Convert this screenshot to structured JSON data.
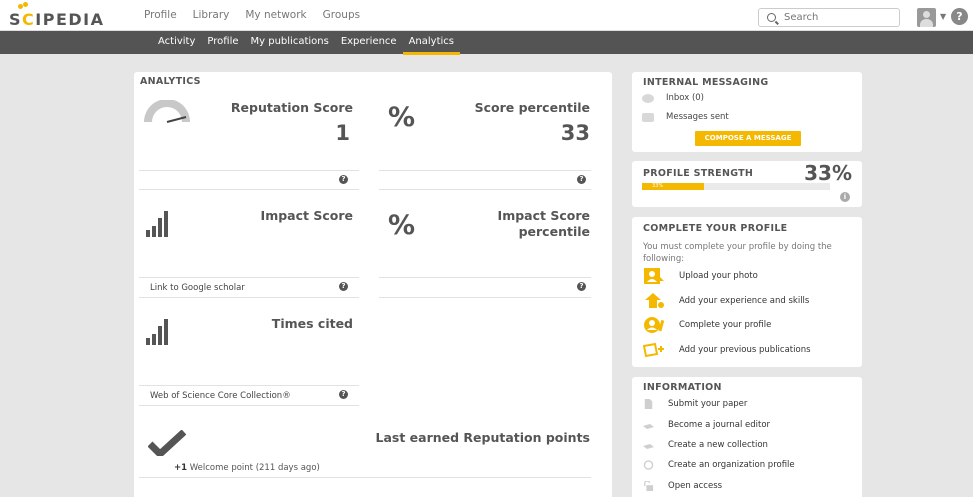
{
  "logo": {
    "text_pre": "S",
    "text_c": "C",
    "text_post": "IPEDIA"
  },
  "topnav": [
    "Profile",
    "Library",
    "My network",
    "Groups"
  ],
  "search": {
    "placeholder": "Search"
  },
  "subnav": [
    "Activity",
    "Profile",
    "My publications",
    "Experience",
    "Analytics"
  ],
  "subnav_active": "Analytics",
  "analytics": {
    "title": "ANALYTICS",
    "reputation": {
      "title": "Reputation Score",
      "value": "1"
    },
    "score_percentile": {
      "icon": "%",
      "title": "Score percentile",
      "value": "33"
    },
    "impact": {
      "title": "Impact Score",
      "footer": "Link to Google scholar"
    },
    "impact_percentile": {
      "icon": "%",
      "title_line1": "Impact Score",
      "title_line2": "percentile"
    },
    "times_cited": {
      "title": "Times cited",
      "footer": "Web of Science Core Collection®"
    },
    "last_points": {
      "title": "Last earned Reputation points",
      "points": "+1",
      "text": " Welcome point (211 days ago)"
    },
    "help_glyph": "?"
  },
  "messaging": {
    "title": "INTERNAL MESSAGING",
    "inbox": "Inbox (0)",
    "sent": "Messages sent",
    "compose": "COMPOSE A MESSAGE"
  },
  "strength": {
    "title": "PROFILE STRENGTH",
    "percent": "33%",
    "bar_label": "33%",
    "fraction": 0.33
  },
  "complete": {
    "title": "COMPLETE YOUR PROFILE",
    "text": "You must complete your profile by doing the following:",
    "items": [
      "Upload your photo",
      "Add your experience and skills",
      "Complete your profile",
      "Add your previous publications"
    ]
  },
  "information": {
    "title": "INFORMATION",
    "items": [
      "Submit your paper",
      "Become a journal editor",
      "Create a new collection",
      "Create an organization profile",
      "Open access"
    ]
  },
  "colors": {
    "accent": "#f5b800",
    "subnav": "#545454",
    "background": "#e6e6e6"
  },
  "icons": [
    "search-icon",
    "user-avatar-icon",
    "help-icon",
    "gauge-icon",
    "bar-chart-icon",
    "percent-icon",
    "checkmark-icon",
    "inbox-icon",
    "sent-icon",
    "photo-icon",
    "skills-icon",
    "profile-icon",
    "publications-icon",
    "document-icon",
    "editor-icon",
    "collection-icon",
    "organization-icon",
    "open-access-icon"
  ]
}
